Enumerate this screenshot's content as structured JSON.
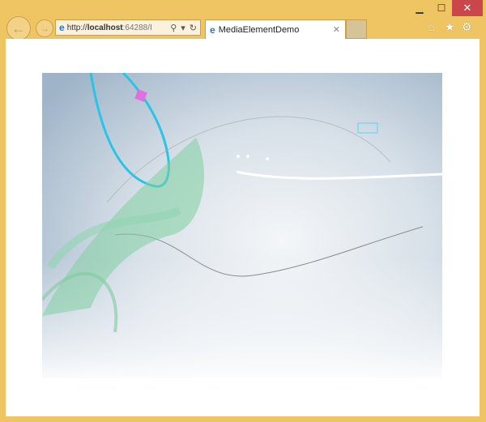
{
  "window": {
    "minimize_icon": "minimize-icon",
    "maximize_icon": "maximize-icon",
    "close_icon": "close-icon",
    "min_glyph": "▁",
    "max_glyph": "☐",
    "close_glyph": "✕"
  },
  "nav": {
    "back_glyph": "←",
    "forward_glyph": "→"
  },
  "address": {
    "scheme": "http://",
    "host": "localhost",
    "rest": ":64288/I",
    "search_glyph": "⚲",
    "dropdown_glyph": "▾",
    "refresh_glyph": "↻",
    "ie_glyph": "e"
  },
  "tab": {
    "title": "MediaElementDemo",
    "close_glyph": "✕"
  },
  "toolbar": {
    "home_glyph": "⌂",
    "star_glyph": "★",
    "gear_glyph": "⚙"
  },
  "colors": {
    "frame": "#efc462",
    "close": "#c9464a"
  }
}
